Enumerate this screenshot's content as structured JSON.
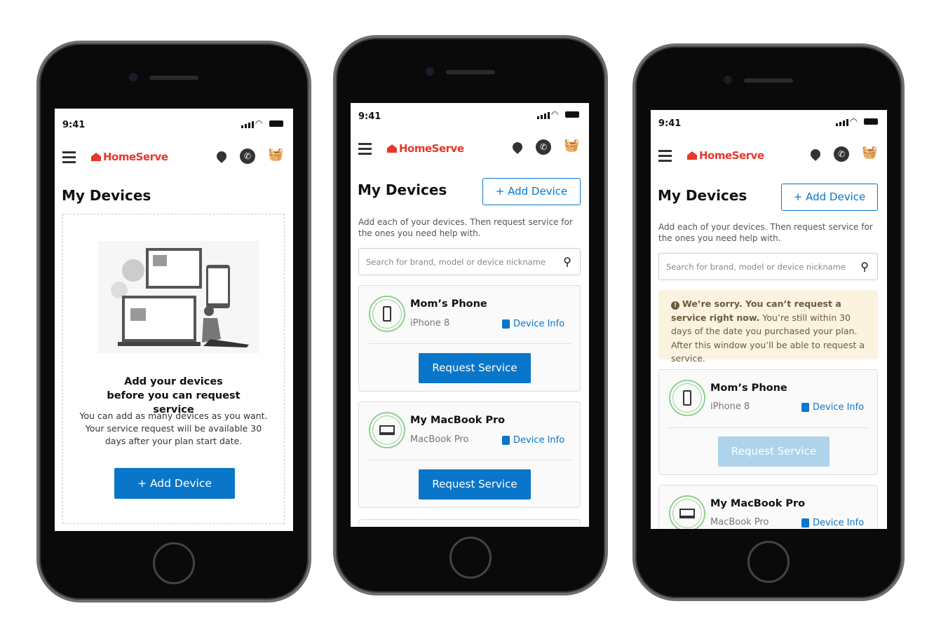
{
  "status_time": "9:41",
  "brand": "HomeServe",
  "page_title": "My Devices",
  "add_device": "+ Add Device",
  "screen1": {
    "heading": "Add your devices before you can request service",
    "body": "You can add as many devices as you want. Your service request will be available 30 days after your plan start date.",
    "button": "+  Add Device"
  },
  "description": "Add each of your devices. Then request service for the ones you need help with.",
  "search_placeholder": "Search for brand, model or device nickname",
  "devices": [
    {
      "name": "Mom’s Phone",
      "model": "iPhone 8",
      "icon": "smartphone-icon"
    },
    {
      "name": "My MacBook Pro",
      "model": "MacBook Pro",
      "icon": "laptop-icon"
    }
  ],
  "device_info": "Device Info",
  "request_service": "Request Service",
  "notice": {
    "bold": "We’re sorry. You can’t request a service right now.",
    "text": " You’re still within 30 days of the date you purchased your plan. After this window you’ll be able to request a service."
  },
  "colors": {
    "brand": "#e8372c",
    "primary": "#0a76c9",
    "disabled": "#aed3ea",
    "notice_bg": "#fbf3df"
  }
}
